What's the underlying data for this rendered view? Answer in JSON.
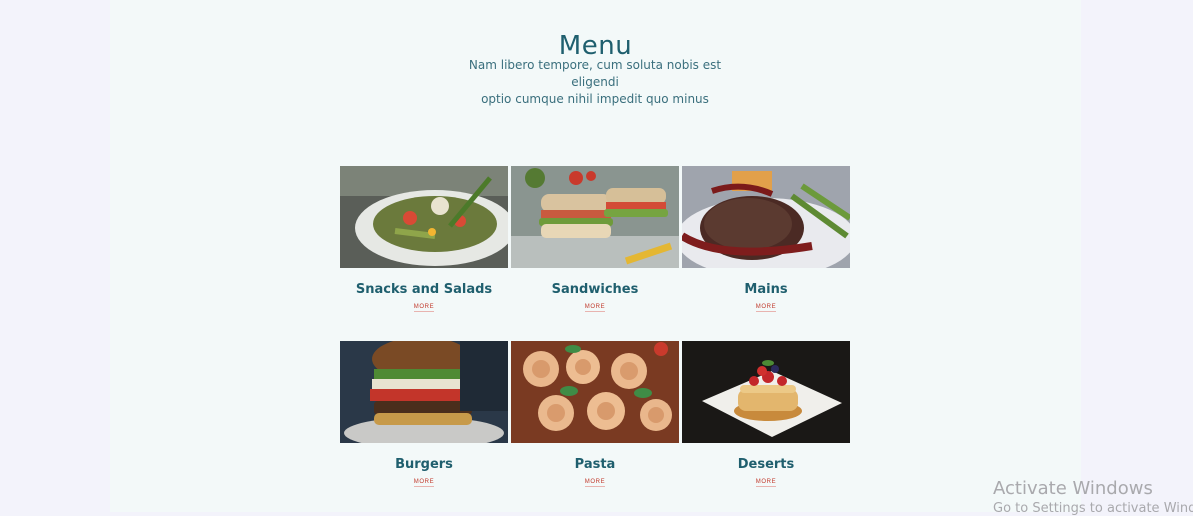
{
  "section": {
    "title": "Menu",
    "subtitle_line1": "Nam libero tempore, cum soluta nobis est eligendi",
    "subtitle_line2": "optio cumque nihil impedit quo minus"
  },
  "menu_items": [
    {
      "name": "Snacks and Salads",
      "more": "MORE",
      "image": "salad-photo"
    },
    {
      "name": "Sandwiches",
      "more": "MORE",
      "image": "sandwich-photo"
    },
    {
      "name": "Mains",
      "more": "MORE",
      "image": "steak-photo"
    },
    {
      "name": "Burgers",
      "more": "MORE",
      "image": "burger-photo"
    },
    {
      "name": "Pasta",
      "more": "MORE",
      "image": "pasta-photo"
    },
    {
      "name": "Deserts",
      "more": "MORE",
      "image": "pancake-photo"
    }
  ],
  "watermark": {
    "line1": "Activate Windows",
    "line2": "Go to Settings to activate Windows."
  },
  "colors": {
    "title": "#1f5f6e",
    "link": "#c0392b",
    "panel_bg": "#f3f9f9",
    "page_bg": "#f3f3fb"
  }
}
